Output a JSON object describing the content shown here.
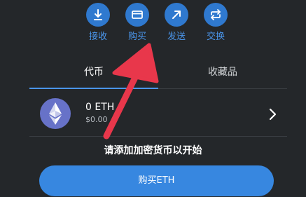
{
  "actions": [
    {
      "label": "接收",
      "icon": "receive-icon"
    },
    {
      "label": "购买",
      "icon": "buy-card-icon"
    },
    {
      "label": "发送",
      "icon": "send-icon"
    },
    {
      "label": "交换",
      "icon": "swap-icon"
    }
  ],
  "tabs": [
    {
      "label": "代币",
      "active": true
    },
    {
      "label": "收藏品",
      "active": false
    }
  ],
  "asset": {
    "name": "0 ETH",
    "value": "$0.00",
    "logo_icon": "ethereum-icon"
  },
  "empty_prompt": "请添加加密货币以开始",
  "buy_button_label": "购买ETH",
  "colors": {
    "background": "#24272a",
    "accent": "#2f79cf",
    "accent_text": "#4a95ea",
    "button": "#3787e0",
    "annotation": "#e8374b"
  }
}
